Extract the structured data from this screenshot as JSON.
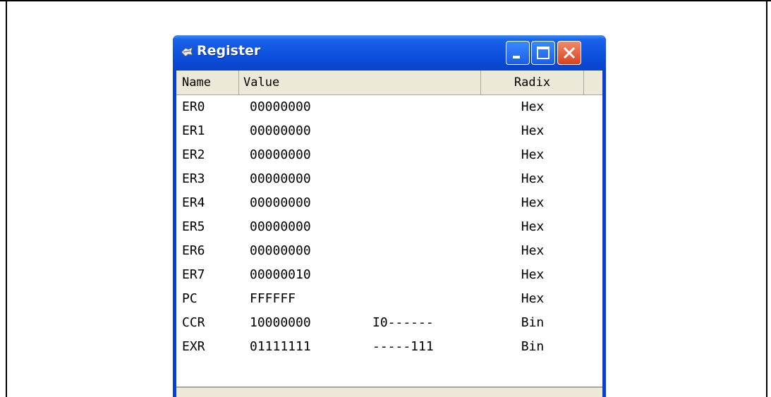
{
  "window": {
    "title": "Register"
  },
  "columns": {
    "name": "Name",
    "value": "Value",
    "radix": "Radix"
  },
  "registers": [
    {
      "name": "ER0",
      "value": "00000000",
      "flags": "",
      "radix": "Hex"
    },
    {
      "name": "ER1",
      "value": "00000000",
      "flags": "",
      "radix": "Hex"
    },
    {
      "name": "ER2",
      "value": "00000000",
      "flags": "",
      "radix": "Hex"
    },
    {
      "name": "ER3",
      "value": "00000000",
      "flags": "",
      "radix": "Hex"
    },
    {
      "name": "ER4",
      "value": "00000000",
      "flags": "",
      "radix": "Hex"
    },
    {
      "name": "ER5",
      "value": "00000000",
      "flags": "",
      "radix": "Hex"
    },
    {
      "name": "ER6",
      "value": "00000000",
      "flags": "",
      "radix": "Hex"
    },
    {
      "name": "ER7",
      "value": "00000010",
      "flags": "",
      "radix": "Hex"
    },
    {
      "name": "PC",
      "value": "FFFFFF",
      "flags": "",
      "radix": "Hex"
    },
    {
      "name": "CCR",
      "value": "10000000",
      "flags": "I0------",
      "radix": "Bin"
    },
    {
      "name": "EXR",
      "value": "01111111",
      "flags": "-----111",
      "radix": "Bin"
    }
  ],
  "icons": {
    "title": "register-app-icon",
    "minimize": "minimize-icon",
    "maximize": "maximize-icon",
    "close": "close-icon"
  },
  "colors": {
    "titlebar": "#0a4ad4",
    "close_button": "#d8431e",
    "header_bg": "#ece9d8"
  }
}
